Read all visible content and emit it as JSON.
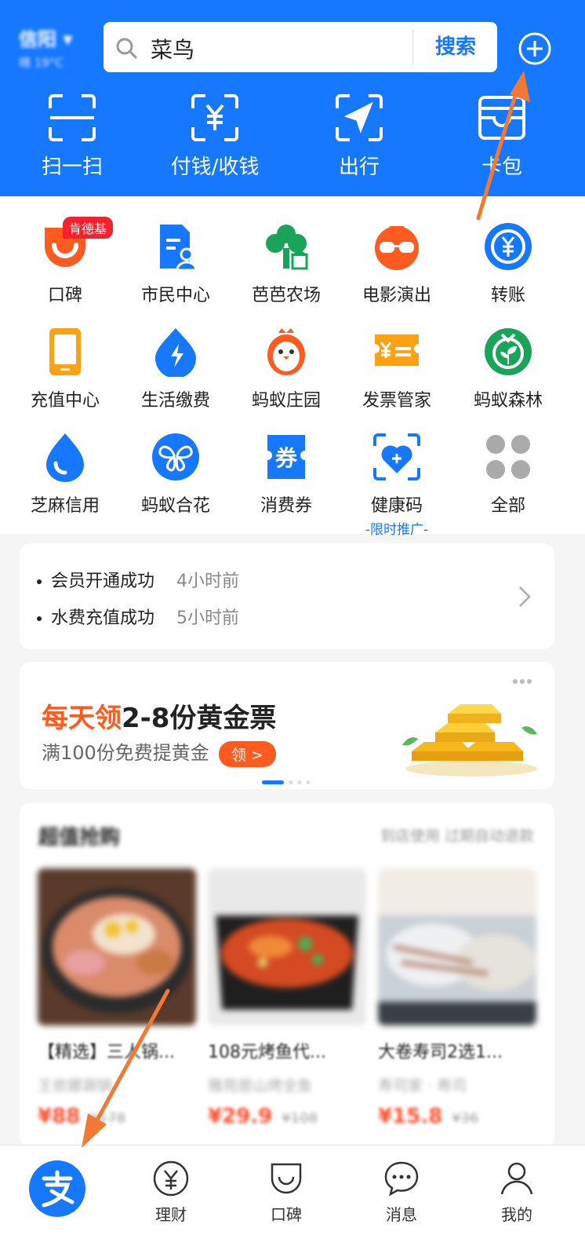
{
  "header": {
    "city": "信阳",
    "weather": "晴 19°C",
    "search_text": "菜鸟",
    "search_button": "搜索"
  },
  "top_nav": [
    {
      "label": "扫一扫",
      "icon": "scan-icon"
    },
    {
      "label": "付钱/收钱",
      "icon": "pay-icon"
    },
    {
      "label": "出行",
      "icon": "travel-icon"
    },
    {
      "label": "卡包",
      "icon": "card-wallet-icon"
    }
  ],
  "apps": [
    {
      "label": "口碑",
      "icon": "koubei-icon",
      "badge": "肯德基"
    },
    {
      "label": "市民中心",
      "icon": "citizen-center-icon"
    },
    {
      "label": "芭芭农场",
      "icon": "baba-farm-icon"
    },
    {
      "label": "电影演出",
      "icon": "movie-icon"
    },
    {
      "label": "转账",
      "icon": "transfer-icon"
    },
    {
      "label": "充值中心",
      "icon": "recharge-icon"
    },
    {
      "label": "生活缴费",
      "icon": "utility-bill-icon"
    },
    {
      "label": "蚂蚁庄园",
      "icon": "ant-manor-icon"
    },
    {
      "label": "发票管家",
      "icon": "invoice-icon"
    },
    {
      "label": "蚂蚁森林",
      "icon": "ant-forest-icon"
    },
    {
      "label": "芝麻信用",
      "icon": "sesame-credit-icon"
    },
    {
      "label": "蚂蚁合花",
      "icon": "huabei-icon"
    },
    {
      "label": "消费券",
      "icon": "coupon-icon"
    },
    {
      "label": "健康码",
      "icon": "health-code-icon",
      "promo": "-限时推广-"
    },
    {
      "label": "全部",
      "icon": "all-apps-icon"
    }
  ],
  "notifications": [
    {
      "text": "会员开通成功",
      "time": "4小时前"
    },
    {
      "text": "水费充值成功",
      "time": "5小时前"
    }
  ],
  "banner": {
    "title_highlight": "每天领",
    "title_rest": "2-8份黄金票",
    "subtitle": "满100份免费提黄金",
    "claim_button": "领 >"
  },
  "deals": {
    "title": "超值抢购",
    "note": "到店使用 过期自动退款",
    "items": [
      {
        "name": "【精选】三人锅...",
        "shop": "王依娜涮锅",
        "price": "¥88",
        "original_price": "¥178"
      },
      {
        "name": "108元烤鱼代...",
        "shop": "雅苑居山烤全鱼",
        "price": "¥29.9",
        "original_price": "¥108"
      },
      {
        "name": "大卷寿司2选1...",
        "shop": "寿司家 · 寿司",
        "price": "¥15.8",
        "original_price": "¥36"
      }
    ]
  },
  "tabbar": [
    {
      "label": "",
      "icon": "alipay-home-icon"
    },
    {
      "label": "理财",
      "icon": "finance-icon"
    },
    {
      "label": "口碑",
      "icon": "koubei-tab-icon"
    },
    {
      "label": "消息",
      "icon": "message-icon"
    },
    {
      "label": "我的",
      "icon": "profile-icon"
    }
  ],
  "colors": {
    "brand_blue": "#1677ff",
    "orange": "#ff5a1f",
    "background": "#f5f5f5",
    "annotation_arrow": "#f07a33"
  }
}
